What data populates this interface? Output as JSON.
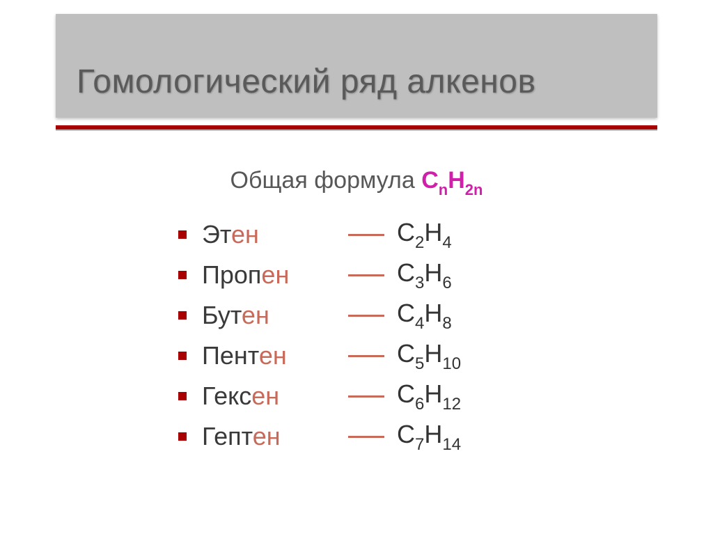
{
  "title": "Гомологический ряд алкенов",
  "formula_label": "Общая формула",
  "general_formula": {
    "C": "C",
    "n1": "n",
    "H": "H",
    "n2": "2n"
  },
  "items": [
    {
      "stem": "Эт",
      "suffix": "ен",
      "c": "2",
      "h": "4"
    },
    {
      "stem": "Проп",
      "suffix": "ен",
      "c": "3",
      "h": "6"
    },
    {
      "stem": "Бут",
      "suffix": "ен",
      "c": "4",
      "h": "8"
    },
    {
      "stem": "Пент",
      "suffix": "ен",
      "c": "5",
      "h": "10"
    },
    {
      "stem": "Гекс",
      "suffix": "ен",
      "c": "6",
      "h": "12"
    },
    {
      "stem": "Гепт",
      "suffix": "ен",
      "c": "7",
      "h": "14"
    }
  ]
}
